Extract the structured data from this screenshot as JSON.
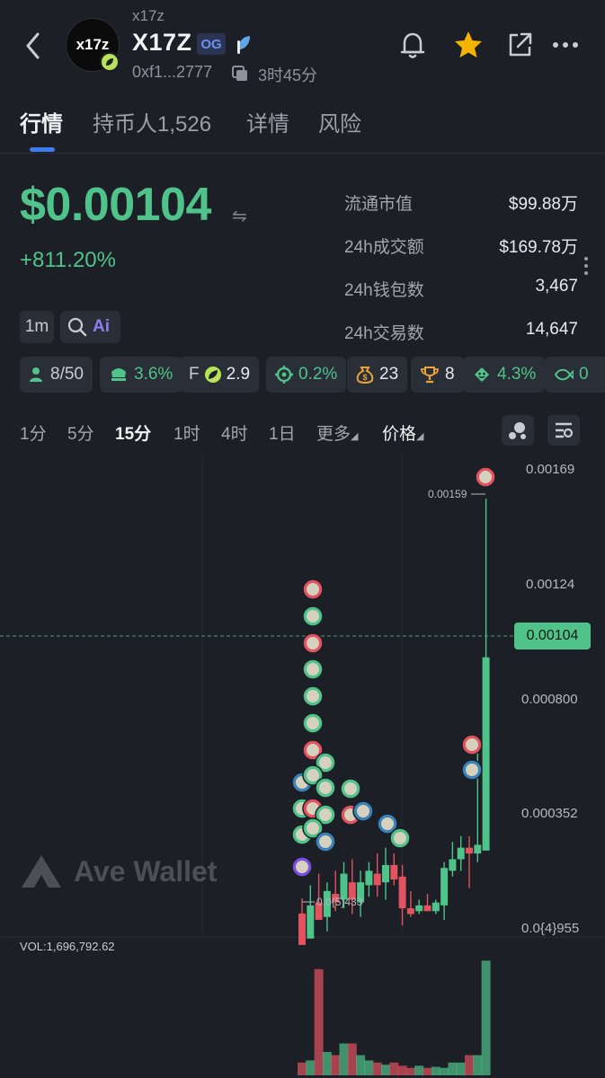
{
  "header": {
    "small_name": "x17z",
    "logo_text": "x17z",
    "title": "X17Z",
    "badge": "OG",
    "address": "0xf1...2777",
    "age": "3时45分"
  },
  "tabs": [
    {
      "label": "行情"
    },
    {
      "label": "持币人1,526"
    },
    {
      "label": "详情"
    },
    {
      "label": "风险"
    }
  ],
  "price": {
    "value": "$0.00104",
    "swap_glyph": "⇋",
    "change": "+811.20%"
  },
  "stats": [
    {
      "label": "流通市值",
      "value": "$99.88万"
    },
    {
      "label": "24h成交额",
      "value": "$169.78万"
    },
    {
      "label": "24h钱包数",
      "value": "3,467"
    },
    {
      "label": "24h交易数",
      "value": "14,647"
    }
  ],
  "tools": {
    "interval": "1m",
    "ai": "Ai"
  },
  "chips": {
    "holders": "8/50",
    "top10": "3.6%",
    "f_letter": "F",
    "f_value": "2.9",
    "target": "0.2%",
    "bags": "23",
    "trophy": "8",
    "smile": "4.3%",
    "last": "0"
  },
  "timeframes": [
    "1分",
    "5分",
    "15分",
    "1时",
    "4时",
    "1日",
    "更多",
    "价格"
  ],
  "colors": {
    "up": "#4fc38a",
    "down": "#e2525f",
    "accent": "#3d7cf0",
    "background": "#1c1f26"
  },
  "chart_data": {
    "type": "candlestick",
    "interval": "15分",
    "y_axis_ticks": [
      "0.00169",
      "0.00124",
      "0.000800",
      "0.000352",
      "0.0{4}955"
    ],
    "current_price_label": "0.00104",
    "high_marker": "0.00159",
    "low_marker": "0.0{5}433",
    "candles": [
      {
        "o": 0.000152,
        "h": 0.000205,
        "l": 4.3e-05,
        "c": 4.3e-05
      },
      {
        "o": 6.5e-05,
        "h": 0.00025,
        "l": 6.5e-05,
        "c": 0.00018
      },
      {
        "o": 0.00019,
        "h": 0.00029,
        "l": 0.00013,
        "c": 0.00013
      },
      {
        "o": 0.00014,
        "h": 0.00026,
        "l": 9e-05,
        "c": 0.00023
      },
      {
        "o": 0.00022,
        "h": 0.0003,
        "l": 0.00016,
        "c": 0.00019
      },
      {
        "o": 0.0002,
        "h": 0.00033,
        "l": 0.00017,
        "c": 0.00029
      },
      {
        "o": 0.00026,
        "h": 0.00034,
        "l": 0.00015,
        "c": 0.0002
      },
      {
        "o": 0.00019,
        "h": 0.0003,
        "l": 0.00014,
        "c": 0.00026
      },
      {
        "o": 0.00025,
        "h": 0.00033,
        "l": 0.00021,
        "c": 0.0003
      },
      {
        "o": 0.00029,
        "h": 0.00036,
        "l": 0.00021,
        "c": 0.00025
      },
      {
        "o": 0.00026,
        "h": 0.00038,
        "l": 0.0002,
        "c": 0.00032
      },
      {
        "o": 0.00032,
        "h": 0.00036,
        "l": 0.00025,
        "c": 0.00027
      },
      {
        "o": 0.00028,
        "h": 0.00032,
        "l": 0.00011,
        "c": 0.00017
      },
      {
        "o": 0.00017,
        "h": 0.00023,
        "l": 0.00014,
        "c": 0.00015
      },
      {
        "o": 0.00016,
        "h": 0.0002,
        "l": 0.00015,
        "c": 0.00018
      },
      {
        "o": 0.00018,
        "h": 0.00022,
        "l": 0.00016,
        "c": 0.00016
      },
      {
        "o": 0.00016,
        "h": 0.0002,
        "l": 0.00015,
        "c": 0.00019
      },
      {
        "o": 0.00018,
        "h": 0.00033,
        "l": 0.00013,
        "c": 0.00031
      },
      {
        "o": 0.0003,
        "h": 0.0004,
        "l": 0.00028,
        "c": 0.00034
      },
      {
        "o": 0.00034,
        "h": 0.00042,
        "l": 0.0003,
        "c": 0.00038
      },
      {
        "o": 0.00038,
        "h": 0.00042,
        "l": 0.00024,
        "c": 0.00036
      },
      {
        "o": 0.00036,
        "h": 0.00072,
        "l": 0.00033,
        "c": 0.00039
      },
      {
        "o": 0.00037,
        "h": 0.00159,
        "l": 0.00037,
        "c": 0.00104
      }
    ],
    "volume_label": "VOL:1,696,792.62",
    "volume": [
      12,
      14,
      100,
      22,
      19,
      30,
      30,
      19,
      14,
      12,
      10,
      12,
      9,
      7,
      9,
      7,
      8,
      7,
      12,
      12,
      19,
      19,
      108
    ]
  }
}
